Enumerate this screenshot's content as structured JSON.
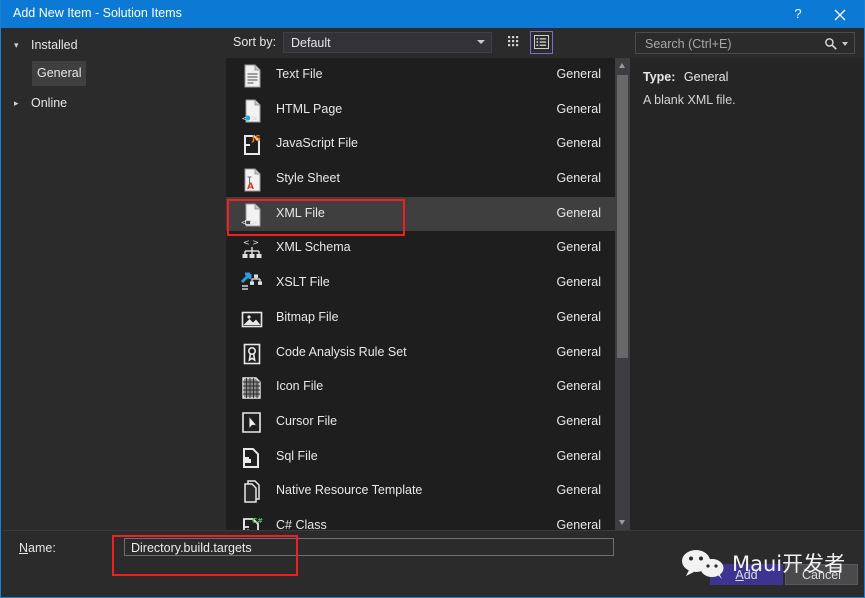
{
  "window": {
    "title": "Add New Item - Solution Items",
    "help_label": "?",
    "close_label": "✕",
    "titlebar_color": "#0c7ad4"
  },
  "sidebar": {
    "items": [
      {
        "label": "Installed",
        "twisty": "◢",
        "expanded": true,
        "selected": false
      },
      {
        "label": "General",
        "twisty": "",
        "expanded": false,
        "selected": true
      },
      {
        "label": "Online",
        "twisty": "▹",
        "expanded": false,
        "selected": false
      }
    ]
  },
  "toolbar": {
    "sort_label": "Sort by:",
    "sort_value": "Default",
    "grid_view_name": "grid-view-icon",
    "list_view_name": "list-view-icon",
    "list_view_active": true,
    "active_border_color": "#7a6fd0"
  },
  "search": {
    "placeholder": "Search (Ctrl+E)",
    "value": ""
  },
  "list": {
    "selected_index": 4,
    "selection_color": "#3f3f40",
    "rows": [
      {
        "label": "Text File",
        "category": "General",
        "icon": "text-file-icon"
      },
      {
        "label": "HTML Page",
        "category": "General",
        "icon": "html-page-icon"
      },
      {
        "label": "JavaScript File",
        "category": "General",
        "icon": "javascript-file-icon"
      },
      {
        "label": "Style Sheet",
        "category": "General",
        "icon": "style-sheet-icon"
      },
      {
        "label": "XML File",
        "category": "General",
        "icon": "xml-file-icon"
      },
      {
        "label": "XML Schema",
        "category": "General",
        "icon": "xml-schema-icon"
      },
      {
        "label": "XSLT File",
        "category": "General",
        "icon": "xslt-file-icon"
      },
      {
        "label": "Bitmap File",
        "category": "General",
        "icon": "bitmap-file-icon"
      },
      {
        "label": "Code Analysis Rule Set",
        "category": "General",
        "icon": "code-analysis-rule-set-icon"
      },
      {
        "label": "Icon File",
        "category": "General",
        "icon": "icon-file-icon"
      },
      {
        "label": "Cursor File",
        "category": "General",
        "icon": "cursor-file-icon"
      },
      {
        "label": "Sql File",
        "category": "General",
        "icon": "sql-file-icon"
      },
      {
        "label": "Native Resource Template",
        "category": "General",
        "icon": "native-resource-template-icon"
      },
      {
        "label": "C# Class",
        "category": "General",
        "icon": "csharp-class-icon"
      }
    ]
  },
  "preview": {
    "type_label": "Type:",
    "type_value": "General",
    "description": "A blank XML file."
  },
  "bottom": {
    "name_label_prefix": "N",
    "name_label_rest": "ame:",
    "name_value": "Directory.build.targets",
    "add_label_prefix": "A",
    "add_label_rest": "dd",
    "cancel_label": "Cancel",
    "add_color": "#3d3391"
  },
  "annotations": {
    "color": "#ef2020",
    "boxes": [
      "xml-file-row",
      "name-input"
    ]
  },
  "watermark": {
    "text": "Maui开发者",
    "icon": "wechat-icon"
  }
}
